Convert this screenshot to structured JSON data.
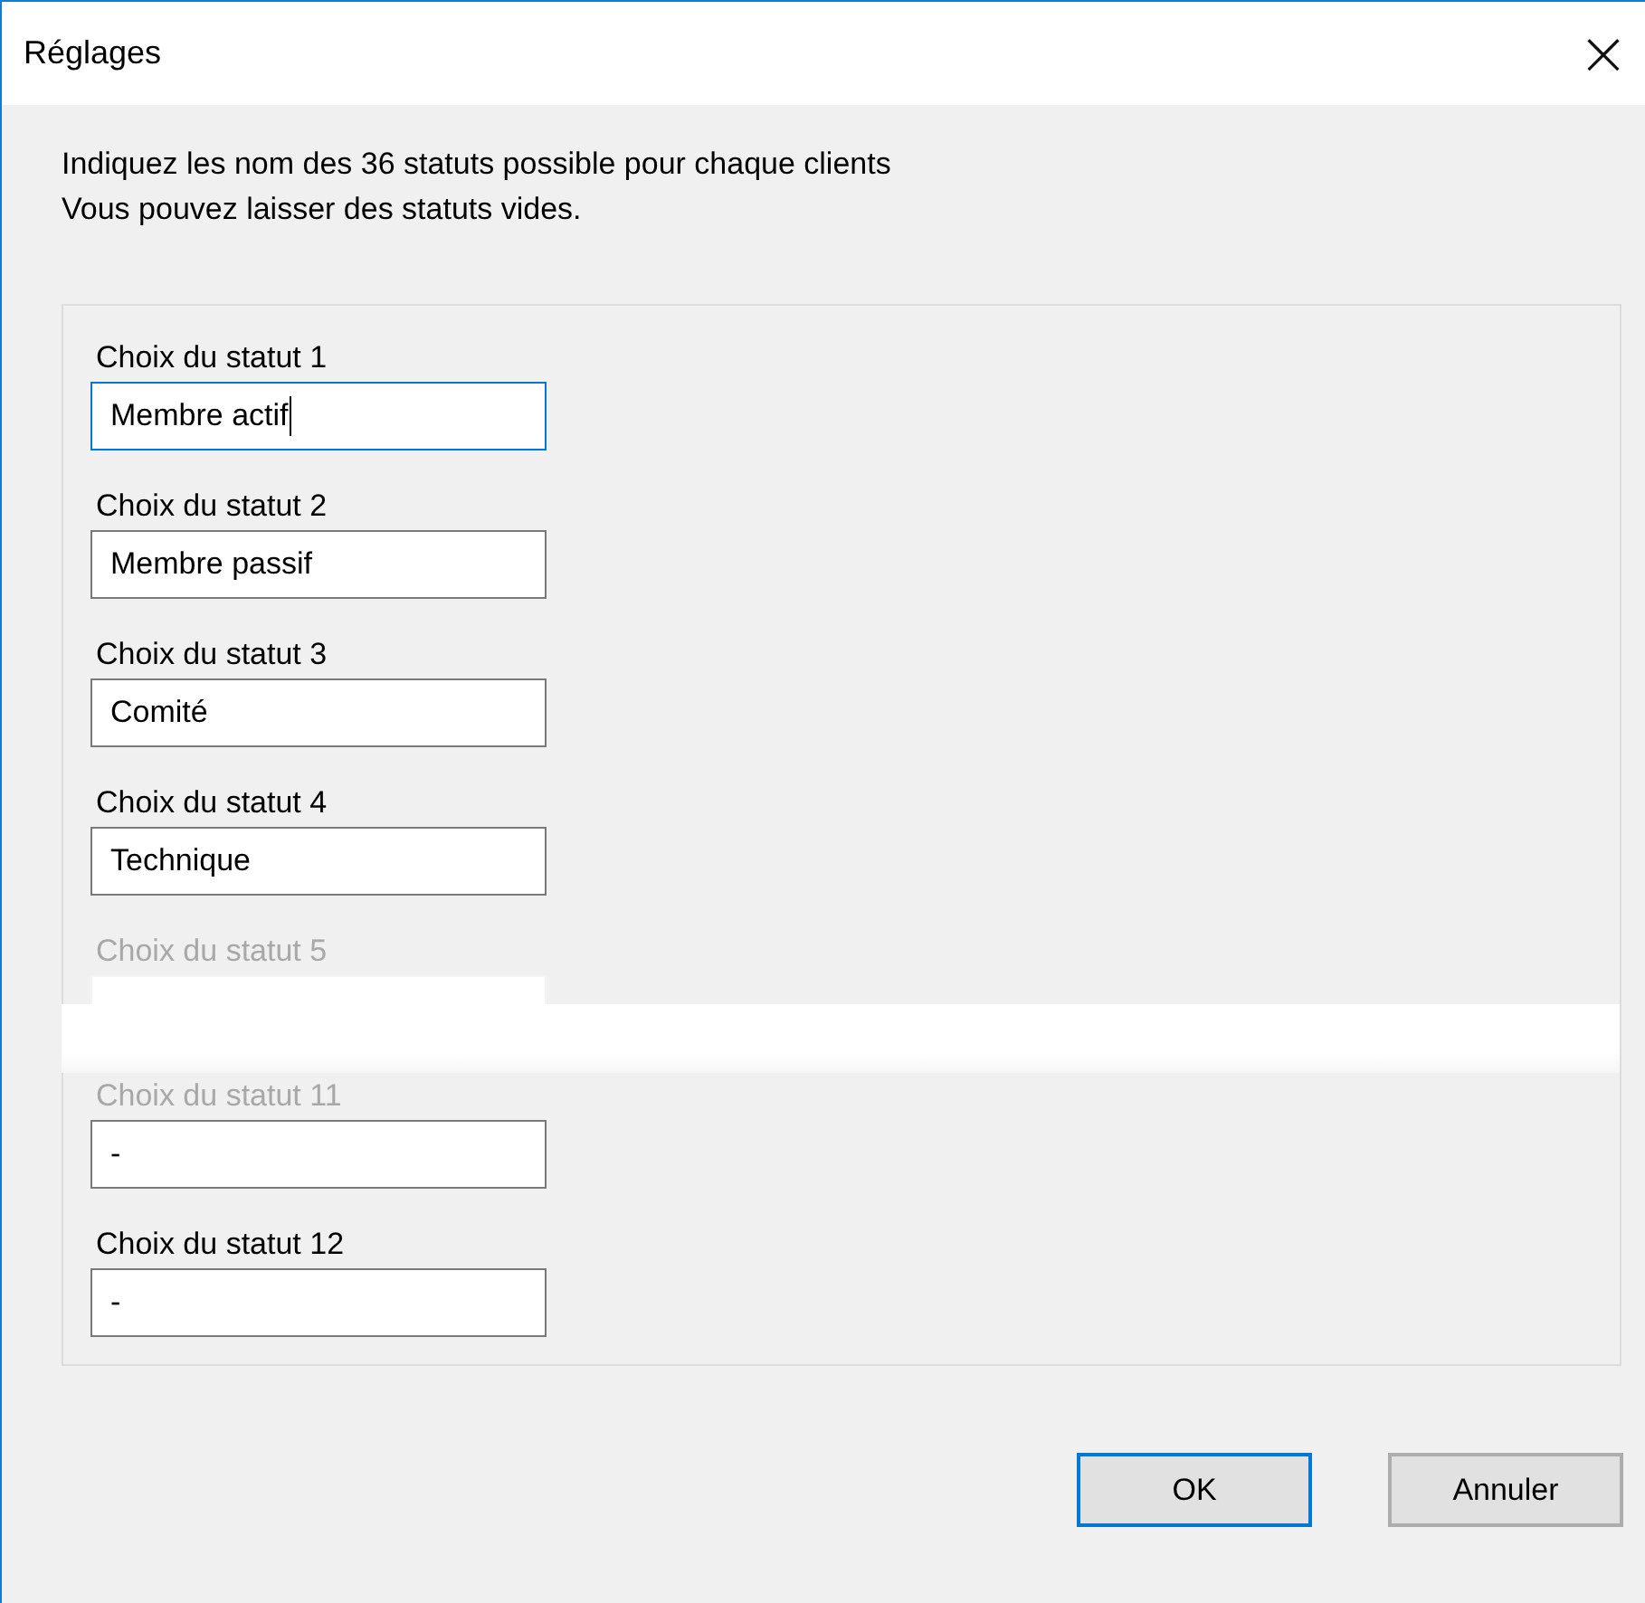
{
  "window": {
    "title": "Réglages",
    "close": "×"
  },
  "intro": [
    "Indiquez les nom des 36 statuts possible pour chaque clients",
    "Vous pouvez laisser des statuts vides."
  ],
  "fields": [
    {
      "kind": "field",
      "label": "Choix du statut 1",
      "value": "Membre actif",
      "focused": true,
      "faded": false
    },
    {
      "kind": "field",
      "label": "Choix du statut 2",
      "value": "Membre passif",
      "focused": false,
      "faded": false
    },
    {
      "kind": "field",
      "label": "Choix du statut 3",
      "value": "Comité",
      "focused": false,
      "faded": false
    },
    {
      "kind": "field",
      "label": "Choix du statut 4",
      "value": "Technique",
      "focused": false,
      "faded": false
    },
    {
      "kind": "field",
      "label": "Choix du statut 5",
      "focused": false,
      "faded": true
    },
    {
      "kind": "break"
    },
    {
      "kind": "field",
      "label": "Choix du statut 11",
      "value": "-",
      "focused": false,
      "faded": true
    },
    {
      "kind": "field",
      "label": "Choix du statut 12",
      "value": "-",
      "focused": false,
      "faded": false
    }
  ],
  "buttons": [
    {
      "label": "OK",
      "default": true
    },
    {
      "label": "Annuler",
      "default": false
    }
  ]
}
